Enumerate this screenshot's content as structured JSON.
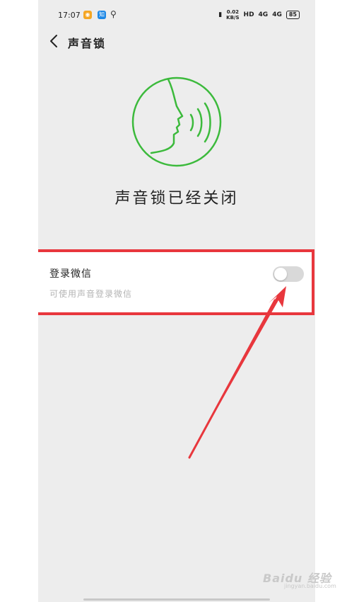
{
  "status_bar": {
    "time": "17:07",
    "weibo_icon_text": "◉",
    "zhihu_icon_text": "知",
    "net_speed_value": "0.02",
    "net_speed_unit": "KB/S",
    "hd_label": "HD",
    "signal1_label": "4G",
    "signal2_label": "4G",
    "battery": "85"
  },
  "nav": {
    "title": "声音锁"
  },
  "main": {
    "status_text": "声音锁已经关闭"
  },
  "setting": {
    "title": "登录微信",
    "subtitle": "可使用声音登录微信",
    "toggle_on": false
  },
  "watermark": {
    "text": "Baidu 经验",
    "sub": "jingyan.baidu.com"
  },
  "colors": {
    "accent_green": "#3cba3c",
    "highlight_red": "#e8373d",
    "toggle_off": "#d9d9d9",
    "background": "#ededed"
  }
}
